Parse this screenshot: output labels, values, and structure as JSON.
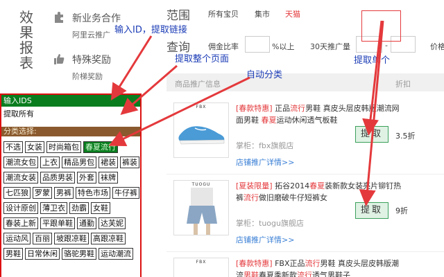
{
  "side_title": [
    "效",
    "果",
    "报",
    "表"
  ],
  "promos": [
    {
      "title": "新业务合作",
      "sub": "阿里云推广",
      "icon": "puzzle-icon"
    },
    {
      "title": "特殊奖励",
      "sub": "阶梯奖励",
      "icon": "thumbs-up-icon"
    }
  ],
  "filter": {
    "scope_label": "范围",
    "scope_items": [
      {
        "label": "所有宝贝",
        "active": false
      },
      {
        "label": "集市",
        "active": false
      },
      {
        "label": "天猫",
        "active": true
      }
    ],
    "query_label": "查询",
    "commission_label": "佣金比率",
    "percent_label": "%以上",
    "promo_volume_label": "30天推广量",
    "dash": "-",
    "price_label": "价格"
  },
  "list_header": {
    "info": "商品推广信息",
    "discount": "折扣"
  },
  "products": [
    {
      "tag": "[春款特惠]",
      "desc_parts": [
        {
          "text": "正品",
          "hl": false
        },
        {
          "text": "流行",
          "hl": true
        },
        {
          "text": "男鞋 真皮头层皮韩版潮流网面男鞋 ",
          "hl": false
        },
        {
          "text": "春夏",
          "hl": true
        },
        {
          "text": "运动休闲透气板鞋",
          "hl": false
        }
      ],
      "shop": "掌柜：fbx旗舰店",
      "detail_link": "店铺推广详情>>",
      "extract_label": "提取",
      "discount": "3.5折",
      "brand": "FBX"
    },
    {
      "tag": "[夏装限量]",
      "desc_parts": [
        {
          "text": "拓谷2014",
          "hl": false
        },
        {
          "text": "春夏",
          "hl": true
        },
        {
          "text": "装新款女装亮片铆钉热裤",
          "hl": false
        },
        {
          "text": "流行",
          "hl": true
        },
        {
          "text": "做旧磨破牛仔短裤女",
          "hl": false
        }
      ],
      "shop": "掌柜：tuogu旗舰店",
      "detail_link": "店铺推广详情>>",
      "extract_label": "提取",
      "discount": "9折",
      "brand": "TUOGU"
    },
    {
      "tag": "[春款特惠]",
      "desc_parts": [
        {
          "text": "FBX正品",
          "hl": false
        },
        {
          "text": "流行",
          "hl": true
        },
        {
          "text": "男鞋 真皮头层皮韩版潮流",
          "hl": false
        },
        {
          "text": "男鞋",
          "hl": true
        },
        {
          "text": "春夏季新款",
          "hl": false
        },
        {
          "text": "流行",
          "hl": true
        },
        {
          "text": "透气男鞋子",
          "hl": false
        }
      ],
      "brand": "FBX"
    }
  ],
  "panel": {
    "input_label": "输入IDS",
    "extract_all": "提取所有",
    "category_label": "分类选择:",
    "chips": [
      "不选",
      "女装",
      "时尚箱包",
      "春夏流行",
      "潮流女包",
      "上衣",
      "精品男包",
      "裙装",
      "裤装",
      "潮流女装",
      "品质男装",
      "外套",
      "袜牌",
      "七匹狼",
      "罗蒙",
      "男裤",
      "特色市场",
      "牛仔裤",
      "设计原创",
      "薄卫衣",
      "劲霸",
      "女鞋",
      "春装上新",
      "平跟单鞋",
      "通勤",
      "达芙妮",
      "运动风",
      "百丽",
      "坡跟凉鞋",
      "高跟凉鞋",
      "男鞋",
      "日常休闲",
      "骆驼男鞋",
      "运动潮流"
    ],
    "active_chip": "春夏流行"
  },
  "annotations": {
    "input_id": "输入ID，提取链接",
    "extract_page": "提取整个页面",
    "auto_classify": "自动分类",
    "extract_single": "提取单个"
  },
  "colors": {
    "accent_red": "#e4393c",
    "panel_green": "#0a7d1f",
    "panel_brown": "#8a5a2e",
    "annot_blue": "#1a3bb5",
    "link_blue": "#3a7fd5"
  }
}
